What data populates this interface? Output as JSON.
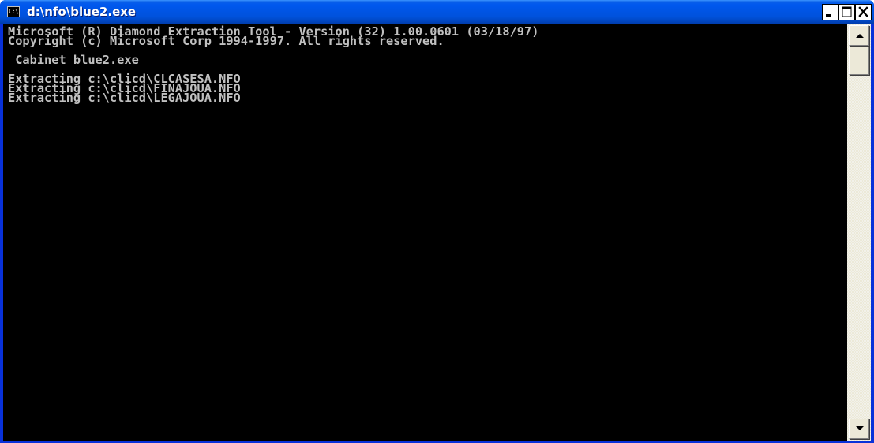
{
  "window": {
    "title": "d:\\nfo\\blue2.exe",
    "icon_label": "C:\\"
  },
  "titlebar_buttons": {
    "minimize": "minimize-icon",
    "maximize": "maximize-icon",
    "close": "close-icon"
  },
  "console": {
    "lines": [
      "Microsoft (R) Diamond Extraction Tool - Version (32) 1.00.0601 (03/18/97)",
      "Copyright (c) Microsoft Corp 1994-1997. All rights reserved.",
      "",
      " Cabinet blue2.exe",
      "",
      "Extracting c:\\clicd\\CLCASESA.NFO",
      "Extracting c:\\clicd\\FINAJOUA.NFO",
      "Extracting c:\\clicd\\LEGAJOUA.NFO"
    ],
    "text_color": "#c0c0c0",
    "background_color": "#000000"
  },
  "colors": {
    "titlebar_blue": "#0055e5",
    "frame_blue": "#0831d9"
  }
}
